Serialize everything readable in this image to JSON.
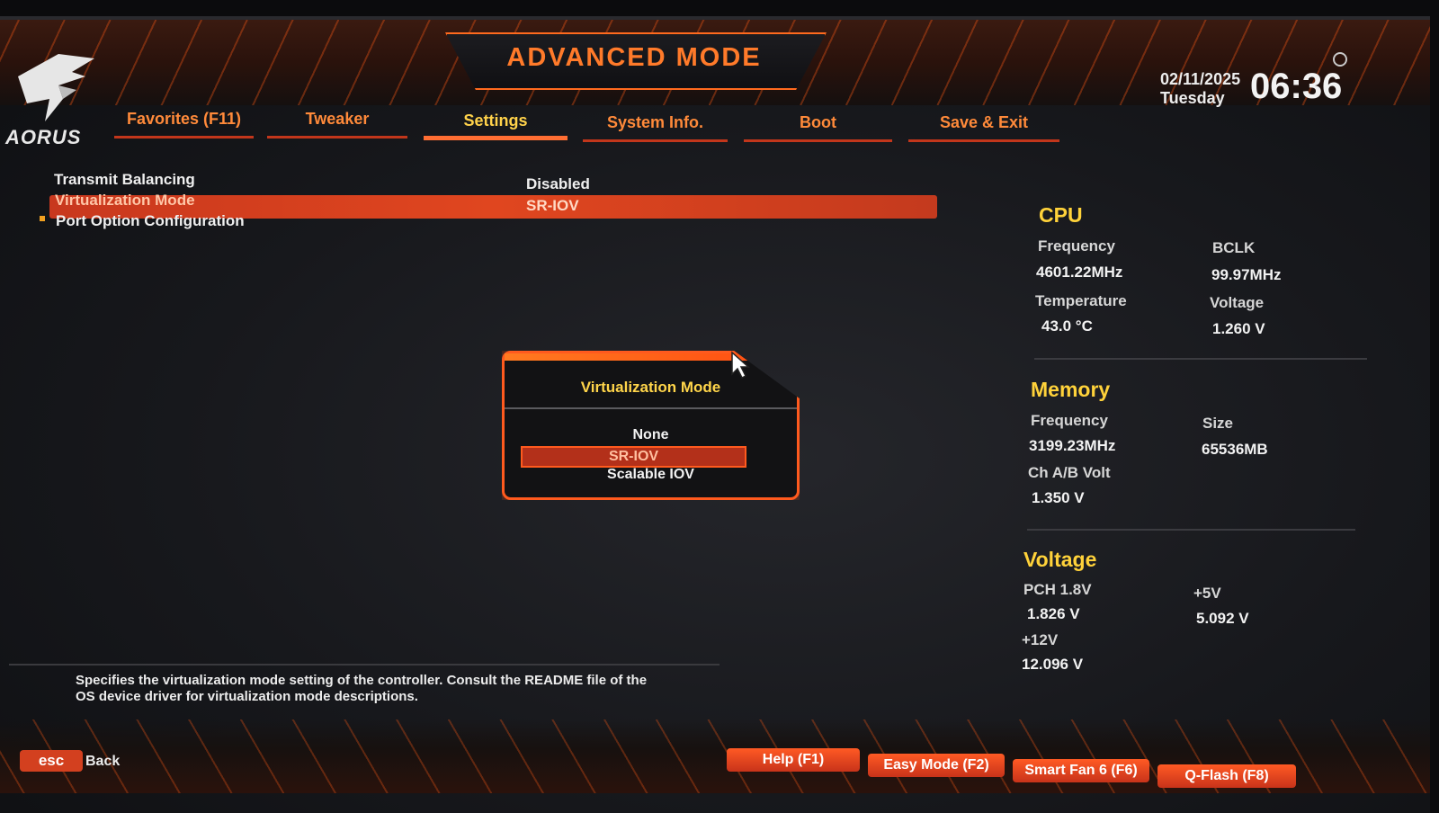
{
  "header": {
    "title": "ADVANCED MODE",
    "brand": "AORUS",
    "date": "02/11/2025",
    "day": "Tuesday",
    "time": "06:36"
  },
  "tabs": [
    {
      "label": "Favorites (F11)",
      "active": false
    },
    {
      "label": "Tweaker",
      "active": false
    },
    {
      "label": "Settings",
      "active": true
    },
    {
      "label": "System Info.",
      "active": false
    },
    {
      "label": "Boot",
      "active": false
    },
    {
      "label": "Save & Exit",
      "active": false
    }
  ],
  "settings": [
    {
      "label": "Transmit Balancing",
      "value": "Disabled"
    },
    {
      "label": "Virtualization Mode",
      "value": "SR-IOV",
      "selected": true
    },
    {
      "label": "Port Option Configuration",
      "value": ""
    }
  ],
  "dialog": {
    "title": "Virtualization Mode",
    "options": [
      "None",
      "SR-IOV",
      "Scalable IOV"
    ],
    "selected": "SR-IOV"
  },
  "cpu": {
    "heading": "CPU",
    "frequency_label": "Frequency",
    "frequency": "4601.22MHz",
    "bclk_label": "BCLK",
    "bclk": "99.97MHz",
    "temperature_label": "Temperature",
    "temperature": "43.0 °C",
    "voltage_label": "Voltage",
    "voltage": "1.260 V"
  },
  "memory": {
    "heading": "Memory",
    "frequency_label": "Frequency",
    "frequency": "3199.23MHz",
    "size_label": "Size",
    "size": "65536MB",
    "volt_label": "Ch A/B Volt",
    "volt": "1.350 V"
  },
  "voltage": {
    "heading": "Voltage",
    "pch_label": "PCH 1.8V",
    "pch": "1.826 V",
    "p5v_label": "+5V",
    "p5v": "5.092 V",
    "p12v_label": "+12V",
    "p12v": "12.096 V"
  },
  "help_text": "Specifies the virtualization mode setting of the controller. Consult the README file of the OS device driver for virtualization mode descriptions.",
  "footer": {
    "esc_label": "esc",
    "back_label": "Back",
    "buttons": [
      "Help (F1)",
      "Easy Mode (F2)",
      "Smart Fan 6 (F6)",
      "Q-Flash (F8)"
    ]
  },
  "colors": {
    "accent": "#ff5a1e",
    "highlight": "#ffd23a",
    "selected_bar": "#d8421f"
  }
}
